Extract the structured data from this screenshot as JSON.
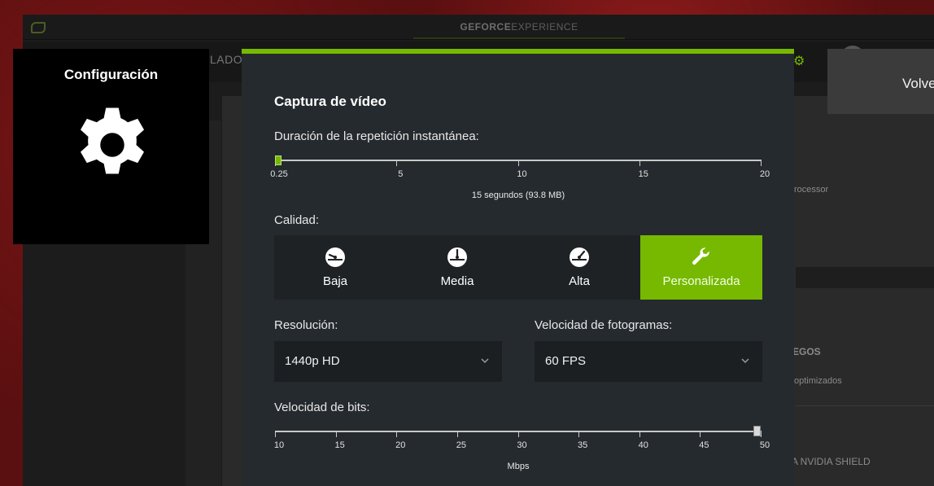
{
  "app": {
    "brand_bold": "GEFORCE",
    "brand_light": "EXPERIENCE",
    "nav_partial": "LADOR"
  },
  "background_texts": {
    "processor": "rocessor",
    "games": "EGOS",
    "optimized": "optimizados",
    "shield": "A NVIDIA SHIELD"
  },
  "config_tile": {
    "title": "Configuración",
    "icon": "gear-icon"
  },
  "back_panel": {
    "label": "Volve"
  },
  "modal": {
    "title": "Captura de vídeo",
    "replay": {
      "label": "Duración de la repetición instantánea:",
      "ticks": [
        "0.25",
        "5",
        "10",
        "15",
        "20"
      ],
      "min": 0.25,
      "max": 20,
      "value": 0.25,
      "caption": "15 segundos (93.8 MB)"
    },
    "quality": {
      "label": "Calidad:",
      "options": [
        {
          "label": "Baja",
          "icon": "speedometer-low-icon",
          "active": false
        },
        {
          "label": "Media",
          "icon": "speedometer-medium-icon",
          "active": false
        },
        {
          "label": "Alta",
          "icon": "speedometer-high-icon",
          "active": false
        },
        {
          "label": "Personalizada",
          "icon": "wrench-icon",
          "active": true
        }
      ]
    },
    "resolution": {
      "label": "Resolución:",
      "value": "1440p HD"
    },
    "framerate": {
      "label": "Velocidad de fotogramas:",
      "value": "60 FPS"
    },
    "bitrate": {
      "label": "Velocidad de bits:",
      "ticks": [
        "10",
        "15",
        "20",
        "25",
        "30",
        "35",
        "40",
        "45",
        "50"
      ],
      "min": 10,
      "max": 50,
      "value": 50,
      "caption": "Mbps"
    }
  },
  "colors": {
    "accent": "#76b900",
    "modal_bg": "#252a2e",
    "button_bg": "#1e2225"
  }
}
